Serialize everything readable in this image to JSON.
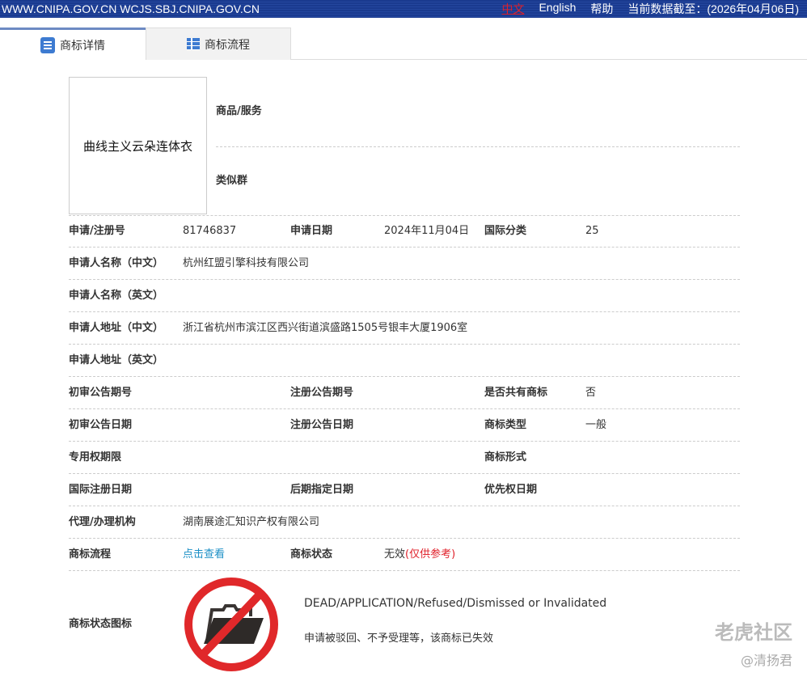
{
  "topbar": {
    "sites": "WWW.CNIPA.GOV.CN WCJS.SBJ.CNIPA.GOV.CN",
    "lang_cn": "中文",
    "lang_en": "English",
    "help": "帮助",
    "data_date": "当前数据截至：(2026年04月06日)"
  },
  "tabs": [
    {
      "label": "商标详情"
    },
    {
      "label": "商标流程"
    }
  ],
  "mark_image_text": "曲线主义云朵连体衣",
  "goods_label": "商品/服务",
  "similar_label": "类似群",
  "fields": {
    "reg_no_label": "申请/注册号",
    "reg_no": "81746837",
    "app_date_label": "申请日期",
    "app_date": "2024年11月04日",
    "intl_class_label": "国际分类",
    "intl_class": "25",
    "applicant_cn_label": "申请人名称（中文）",
    "applicant_cn": "杭州红盟引擎科技有限公司",
    "applicant_en_label": "申请人名称（英文）",
    "address_cn_label": "申请人地址（中文）",
    "address_cn": "浙江省杭州市滨江区西兴街道滨盛路1505号银丰大厦1906室",
    "address_en_label": "申请人地址（英文）",
    "prelim_no_label": "初审公告期号",
    "reg_pub_no_label": "注册公告期号",
    "shared_label": "是否共有商标",
    "shared": "否",
    "prelim_date_label": "初审公告日期",
    "reg_pub_date_label": "注册公告日期",
    "type_label": "商标类型",
    "type": "一般",
    "excl_label": "专用权期限",
    "form_label": "商标形式",
    "intl_reg_label": "国际注册日期",
    "later_label": "后期指定日期",
    "priority_label": "优先权日期",
    "agent_label": "代理/办理机构",
    "agent": "湖南展途汇知识产权有限公司",
    "flow_label": "商标流程",
    "flow_link": "点击查看",
    "status_label": "商标状态",
    "status": "无效",
    "status_note": "(仅供参考)",
    "status_icon_label": "商标状态图标",
    "status_en": "DEAD/APPLICATION/Refused/Dismissed or Invalidated",
    "status_cn": "申请被驳回、不予受理等，该商标已失效"
  },
  "watermark": {
    "brand": "老虎社区",
    "author": "@清扬君"
  }
}
